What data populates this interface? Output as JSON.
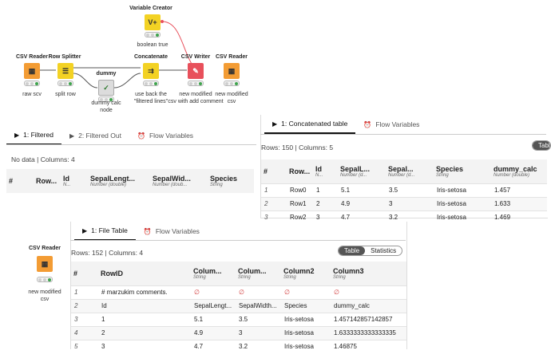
{
  "workflow": {
    "variable_creator": {
      "title": "Variable Creator",
      "caption": "boolean true",
      "icon": "V+"
    },
    "csv_reader": {
      "title": "CSV Reader",
      "caption": "raw scv"
    },
    "row_splitter": {
      "title": "Row Splitter",
      "caption": "split row"
    },
    "dummy": {
      "title": "dummy",
      "caption_line1": "dummy calc",
      "caption_line2": "node"
    },
    "concatenate": {
      "title": "Concatenate",
      "caption_line1": "use back the",
      "caption_line2": "\"filtered lines\""
    },
    "csv_writer": {
      "title": "CSV Writer",
      "caption_line1": "new modified",
      "caption_line2": "csv with add comment"
    },
    "csv_reader2": {
      "title": "CSV Reader",
      "caption_line1": "new modified",
      "caption_line2": "csv"
    }
  },
  "panel_filtered": {
    "tabs": [
      "1: Filtered",
      "2: Filtered Out",
      "Flow Variables"
    ],
    "info": "No data  |  Columns: 4",
    "columns": [
      {
        "name": "#",
        "type": ""
      },
      {
        "name": "Row...",
        "type": ""
      },
      {
        "name": "Id",
        "type": "N..."
      },
      {
        "name": "SepalLengt...",
        "type": "Number (double)"
      },
      {
        "name": "SepalWid...",
        "type": "Number (doub..."
      },
      {
        "name": "Species",
        "type": "String"
      }
    ]
  },
  "panel_concat": {
    "tabs": [
      "1: Concatenated table",
      "Flow Variables"
    ],
    "info": "Rows: 150  |  Columns: 5",
    "toggle_label": "Table",
    "columns": [
      {
        "name": "#",
        "type": ""
      },
      {
        "name": "Row...",
        "type": ""
      },
      {
        "name": "Id",
        "type": "N..."
      },
      {
        "name": "SepalL...",
        "type": "Number (d..."
      },
      {
        "name": "Sepal...",
        "type": "Number (d..."
      },
      {
        "name": "Species",
        "type": "String"
      },
      {
        "name": "dummy_calc",
        "type": "Number (double)"
      }
    ],
    "rows": [
      [
        "1",
        "Row0",
        "1",
        "5.1",
        "3.5",
        "Iris-setosa",
        "1.457"
      ],
      [
        "2",
        "Row1",
        "2",
        "4.9",
        "3",
        "Iris-setosa",
        "1.633"
      ],
      [
        "3",
        "Row2",
        "3",
        "4.7",
        "3.2",
        "Iris-setosa",
        "1.469"
      ]
    ]
  },
  "panel_file": {
    "node": {
      "title": "CSV Reader",
      "caption_line1": "new modified",
      "caption_line2": "csv"
    },
    "tabs": [
      "1: File Table",
      "Flow Variables"
    ],
    "info": "Rows: 152  |  Columns: 4",
    "toggle": [
      "Table",
      "Statistics"
    ],
    "columns": [
      {
        "name": "#",
        "type": ""
      },
      {
        "name": "RowID",
        "type": ""
      },
      {
        "name": "Colum...",
        "type": "String"
      },
      {
        "name": "Colum...",
        "type": "String"
      },
      {
        "name": "Column2",
        "type": "String"
      },
      {
        "name": "Column3",
        "type": "String"
      }
    ],
    "rows": [
      [
        "1",
        "# marzukim comments.",
        "∅",
        "∅",
        "∅",
        "∅"
      ],
      [
        "2",
        "Id",
        "SepalLengt...",
        "SepalWidth...",
        "Species",
        "dummy_calc"
      ],
      [
        "3",
        "1",
        "5.1",
        "3.5",
        "Iris-setosa",
        "1.457142857142857"
      ],
      [
        "4",
        "2",
        "4.9",
        "3",
        "Iris-setosa",
        "1.6333333333333335"
      ],
      [
        "5",
        "3",
        "4.7",
        "3.2",
        "Iris-setosa",
        "1.46875"
      ]
    ]
  },
  "colors": {
    "orange": "#f39c34",
    "yellow": "#f3d224",
    "red": "#e8505b",
    "flow_var_line": "#e8505b",
    "ok_green": "#3fa34d"
  }
}
